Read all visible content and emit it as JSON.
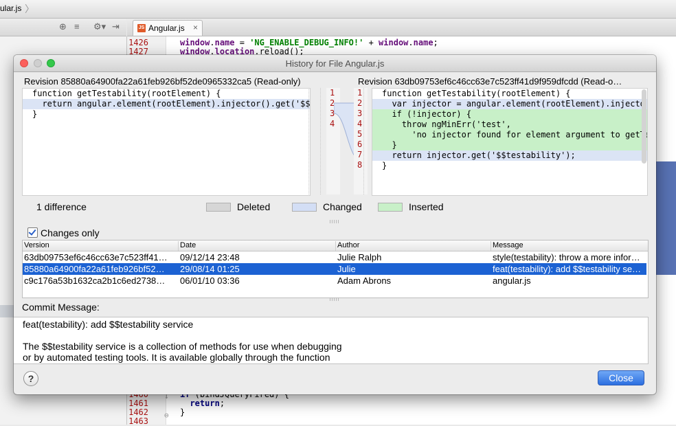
{
  "ide": {
    "breadcrumb": "ular.js",
    "tab_label": "Angular.js",
    "tab_badge": "JS",
    "tab_close": "×",
    "top_lines": [
      {
        "ln": "1426",
        "parts": [
          [
            "fld",
            "window"
          ],
          [
            "",
            "."
          ],
          [
            "fld",
            "name"
          ],
          [
            "",
            " = "
          ],
          [
            "str",
            "'NG_ENABLE_DEBUG_INFO!'"
          ],
          [
            "",
            " + "
          ],
          [
            "fld",
            "window"
          ],
          [
            "",
            "."
          ],
          [
            "fld",
            "name"
          ],
          [
            "",
            ";"
          ]
        ]
      },
      {
        "ln": "1427",
        "parts": [
          [
            "fld",
            "window"
          ],
          [
            "",
            "."
          ],
          [
            "fld",
            "location"
          ],
          [
            "",
            "."
          ],
          [
            "",
            "reload"
          ],
          [
            "",
            "();"
          ]
        ]
      }
    ],
    "bottom_lines": [
      {
        "ln": "1460",
        "parts": [
          [
            "kw",
            "if"
          ],
          [
            "",
            " (bindJQueryFired) {"
          ]
        ]
      },
      {
        "ln": "1461",
        "parts": [
          [
            "",
            "  "
          ],
          [
            "kw",
            "return"
          ],
          [
            "",
            ";"
          ]
        ]
      },
      {
        "ln": "1462",
        "parts": [
          [
            "",
            "}"
          ]
        ]
      },
      {
        "ln": "1463",
        "parts": [
          [
            "",
            ""
          ]
        ]
      }
    ]
  },
  "dialog": {
    "title": "History for File Angular.js",
    "left_header": "Revision 85880a64900fa22a61feb926bf52de0965332ca5 (Read-only)",
    "right_header": "Revision 63db09753ef6c46cc63e7c523ff41d9f959dfcdd (Read-o…",
    "left_code": [
      {
        "text": "function getTestability(rootElement) {",
        "type": ""
      },
      {
        "text": "  return angular.element(rootElement).injector().get('$$te",
        "type": "changed"
      },
      {
        "text": "}",
        "type": ""
      }
    ],
    "left_line_numbers": [
      "1",
      "2",
      "3",
      "4"
    ],
    "right_line_numbers": [
      "1",
      "2",
      "3",
      "4",
      "5",
      "6",
      "7",
      "8"
    ],
    "right_code": [
      {
        "text": "function getTestability(rootElement) {",
        "type": ""
      },
      {
        "text": "  var injector = angular.element(rootElement).injecto",
        "type": "changed"
      },
      {
        "text": "  if (!injector) {",
        "type": "inserted"
      },
      {
        "text": "    throw ngMinErr('test',",
        "type": "inserted"
      },
      {
        "text": "      'no injector found for element argument to getTe",
        "type": "inserted"
      },
      {
        "text": "  }",
        "type": "inserted"
      },
      {
        "text": "  return injector.get('$$testability');",
        "type": "changed"
      },
      {
        "text": "}",
        "type": ""
      }
    ],
    "diff_count": "1 difference",
    "legend": {
      "deleted": "Deleted",
      "changed": "Changed",
      "inserted": "Inserted"
    },
    "colors": {
      "deleted": "#d6d6d6",
      "changed": "#d3def5",
      "inserted": "#c8f0c8",
      "selection": "#1c62d3"
    },
    "changes_only_label": "Changes only",
    "changes_only_checked": true,
    "table": {
      "headers": [
        "Version",
        "Date",
        "Author",
        "Message"
      ],
      "rows": [
        {
          "version": "63db09753ef6c46cc63e7c523ff41…",
          "date": "09/12/14 23:48",
          "author": "Julie Ralph",
          "message": "style(testability): throw a more infor…",
          "selected": false
        },
        {
          "version": "85880a64900fa22a61feb926bf52…",
          "date": "29/08/14 01:25",
          "author": "Julie",
          "message": "feat(testability): add $$testability se…",
          "selected": true
        },
        {
          "version": "c9c176a53b1632ca2b1c6ed2738…",
          "date": "06/01/10 03:36",
          "author": "Adam Abrons",
          "message": "angular.js",
          "selected": false
        }
      ]
    },
    "commit_label": "Commit Message:",
    "commit_lines": [
      "feat(testability): add $$testability service",
      "",
      "The $$testability service is a collection of methods for use when debugging",
      "or by automated testing tools. It is available globally through the function"
    ],
    "help_label": "?",
    "close_label": "Close"
  }
}
